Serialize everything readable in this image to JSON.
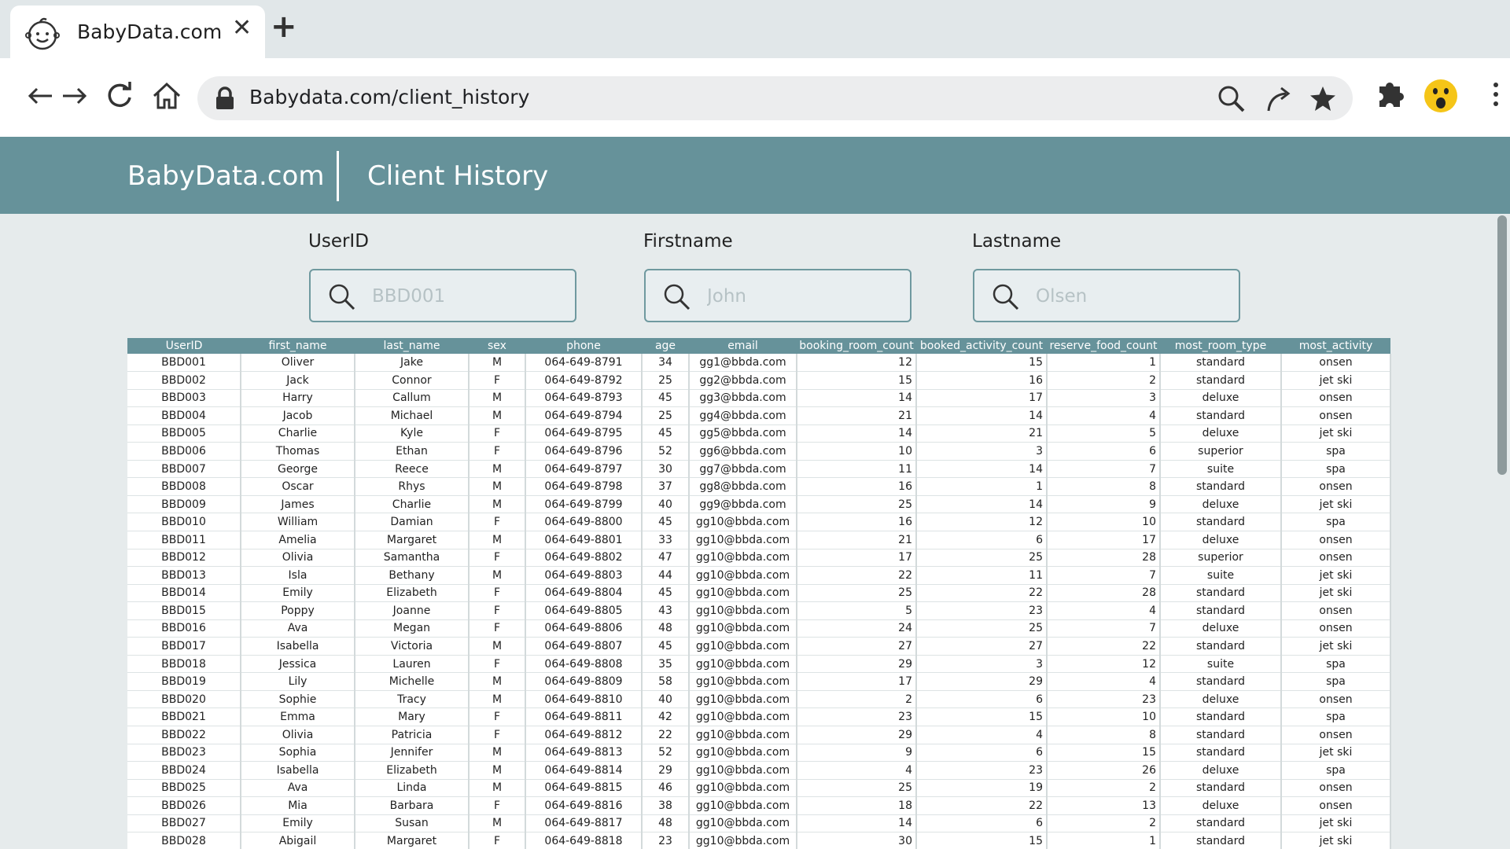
{
  "browser": {
    "tab_title": "BabyData.com",
    "tab_close": "✕",
    "new_tab": "+",
    "url": "Babydata.com/client_history",
    "icons": [
      "baby-face-icon",
      "back-arrow-icon",
      "forward-arrow-icon",
      "reload-icon",
      "home-icon",
      "lock-icon",
      "search-icon",
      "share-icon",
      "star-icon",
      "puzzle-icon",
      "avatar-icon",
      "kebab-menu-icon"
    ]
  },
  "header": {
    "brand": "BabyData.com",
    "title": "Client History",
    "color": "#66929a"
  },
  "filters": [
    {
      "label": "UserID",
      "placeholder": "BBD001"
    },
    {
      "label": "Firstname",
      "placeholder": "John"
    },
    {
      "label": "Lastname",
      "placeholder": "Olsen"
    }
  ],
  "table": {
    "columns": [
      "UserID",
      "first_name",
      "last_name",
      "sex",
      "phone",
      "age",
      "email",
      "booking_room_count",
      "booked_activity_count",
      "reserve_food_count",
      "most_room_type",
      "most_activity"
    ],
    "rows": [
      [
        "BBD001",
        "Oliver",
        "Jake",
        "M",
        "064-649-8791",
        "34",
        "gg1@bbda.com",
        "12",
        "15",
        "1",
        "standard",
        "onsen"
      ],
      [
        "BBD002",
        "Jack",
        "Connor",
        "F",
        "064-649-8792",
        "25",
        "gg2@bbda.com",
        "15",
        "16",
        "2",
        "standard",
        "jet ski"
      ],
      [
        "BBD003",
        "Harry",
        "Callum",
        "M",
        "064-649-8793",
        "45",
        "gg3@bbda.com",
        "14",
        "17",
        "3",
        "deluxe",
        "onsen"
      ],
      [
        "BBD004",
        "Jacob",
        "Michael",
        "M",
        "064-649-8794",
        "25",
        "gg4@bbda.com",
        "21",
        "14",
        "4",
        "standard",
        "onsen"
      ],
      [
        "BBD005",
        "Charlie",
        "Kyle",
        "F",
        "064-649-8795",
        "45",
        "gg5@bbda.com",
        "14",
        "21",
        "5",
        "deluxe",
        "jet ski"
      ],
      [
        "BBD006",
        "Thomas",
        "Ethan",
        "F",
        "064-649-8796",
        "52",
        "gg6@bbda.com",
        "10",
        "3",
        "6",
        "superior",
        "spa"
      ],
      [
        "BBD007",
        "George",
        "Reece",
        "M",
        "064-649-8797",
        "30",
        "gg7@bbda.com",
        "11",
        "14",
        "7",
        "suite",
        "spa"
      ],
      [
        "BBD008",
        "Oscar",
        "Rhys",
        "M",
        "064-649-8798",
        "37",
        "gg8@bbda.com",
        "16",
        "1",
        "8",
        "standard",
        "onsen"
      ],
      [
        "BBD009",
        "James",
        "Charlie",
        "M",
        "064-649-8799",
        "40",
        "gg9@bbda.com",
        "25",
        "14",
        "9",
        "deluxe",
        "jet ski"
      ],
      [
        "BBD010",
        "William",
        "Damian",
        "F",
        "064-649-8800",
        "45",
        "gg10@bbda.com",
        "16",
        "12",
        "10",
        "standard",
        "spa"
      ],
      [
        "BBD011",
        "Amelia",
        "Margaret",
        "M",
        "064-649-8801",
        "33",
        "gg10@bbda.com",
        "21",
        "6",
        "17",
        "deluxe",
        "onsen"
      ],
      [
        "BBD012",
        "Olivia",
        "Samantha",
        "F",
        "064-649-8802",
        "47",
        "gg10@bbda.com",
        "17",
        "25",
        "28",
        "superior",
        "onsen"
      ],
      [
        "BBD013",
        "Isla",
        "Bethany",
        "M",
        "064-649-8803",
        "44",
        "gg10@bbda.com",
        "22",
        "11",
        "7",
        "suite",
        "jet ski"
      ],
      [
        "BBD014",
        "Emily",
        "Elizabeth",
        "F",
        "064-649-8804",
        "45",
        "gg10@bbda.com",
        "25",
        "22",
        "28",
        "standard",
        "jet ski"
      ],
      [
        "BBD015",
        "Poppy",
        "Joanne",
        "F",
        "064-649-8805",
        "43",
        "gg10@bbda.com",
        "5",
        "23",
        "4",
        "standard",
        "onsen"
      ],
      [
        "BBD016",
        "Ava",
        "Megan",
        "F",
        "064-649-8806",
        "48",
        "gg10@bbda.com",
        "24",
        "25",
        "7",
        "deluxe",
        "onsen"
      ],
      [
        "BBD017",
        "Isabella",
        "Victoria",
        "M",
        "064-649-8807",
        "45",
        "gg10@bbda.com",
        "27",
        "27",
        "22",
        "standard",
        "jet ski"
      ],
      [
        "BBD018",
        "Jessica",
        "Lauren",
        "F",
        "064-649-8808",
        "35",
        "gg10@bbda.com",
        "29",
        "3",
        "12",
        "suite",
        "spa"
      ],
      [
        "BBD019",
        "Lily",
        "Michelle",
        "M",
        "064-649-8809",
        "58",
        "gg10@bbda.com",
        "17",
        "29",
        "4",
        "standard",
        "spa"
      ],
      [
        "BBD020",
        "Sophie",
        "Tracy",
        "M",
        "064-649-8810",
        "40",
        "gg10@bbda.com",
        "2",
        "6",
        "23",
        "deluxe",
        "onsen"
      ],
      [
        "BBD021",
        "Emma",
        "Mary",
        "F",
        "064-649-8811",
        "42",
        "gg10@bbda.com",
        "23",
        "15",
        "10",
        "standard",
        "spa"
      ],
      [
        "BBD022",
        "Olivia",
        "Patricia",
        "F",
        "064-649-8812",
        "22",
        "gg10@bbda.com",
        "29",
        "4",
        "8",
        "standard",
        "onsen"
      ],
      [
        "BBD023",
        "Sophia",
        "Jennifer",
        "M",
        "064-649-8813",
        "52",
        "gg10@bbda.com",
        "9",
        "6",
        "15",
        "standard",
        "jet ski"
      ],
      [
        "BBD024",
        "Isabella",
        "Elizabeth",
        "M",
        "064-649-8814",
        "29",
        "gg10@bbda.com",
        "4",
        "23",
        "26",
        "deluxe",
        "spa"
      ],
      [
        "BBD025",
        "Ava",
        "Linda",
        "M",
        "064-649-8815",
        "46",
        "gg10@bbda.com",
        "25",
        "19",
        "2",
        "standard",
        "onsen"
      ],
      [
        "BBD026",
        "Mia",
        "Barbara",
        "F",
        "064-649-8816",
        "38",
        "gg10@bbda.com",
        "18",
        "22",
        "13",
        "deluxe",
        "onsen"
      ],
      [
        "BBD027",
        "Emily",
        "Susan",
        "M",
        "064-649-8817",
        "48",
        "gg10@bbda.com",
        "14",
        "6",
        "2",
        "standard",
        "jet ski"
      ],
      [
        "BBD028",
        "Abigail",
        "Margaret",
        "F",
        "064-649-8818",
        "23",
        "gg10@bbda.com",
        "30",
        "15",
        "1",
        "standard",
        "jet ski"
      ]
    ]
  }
}
